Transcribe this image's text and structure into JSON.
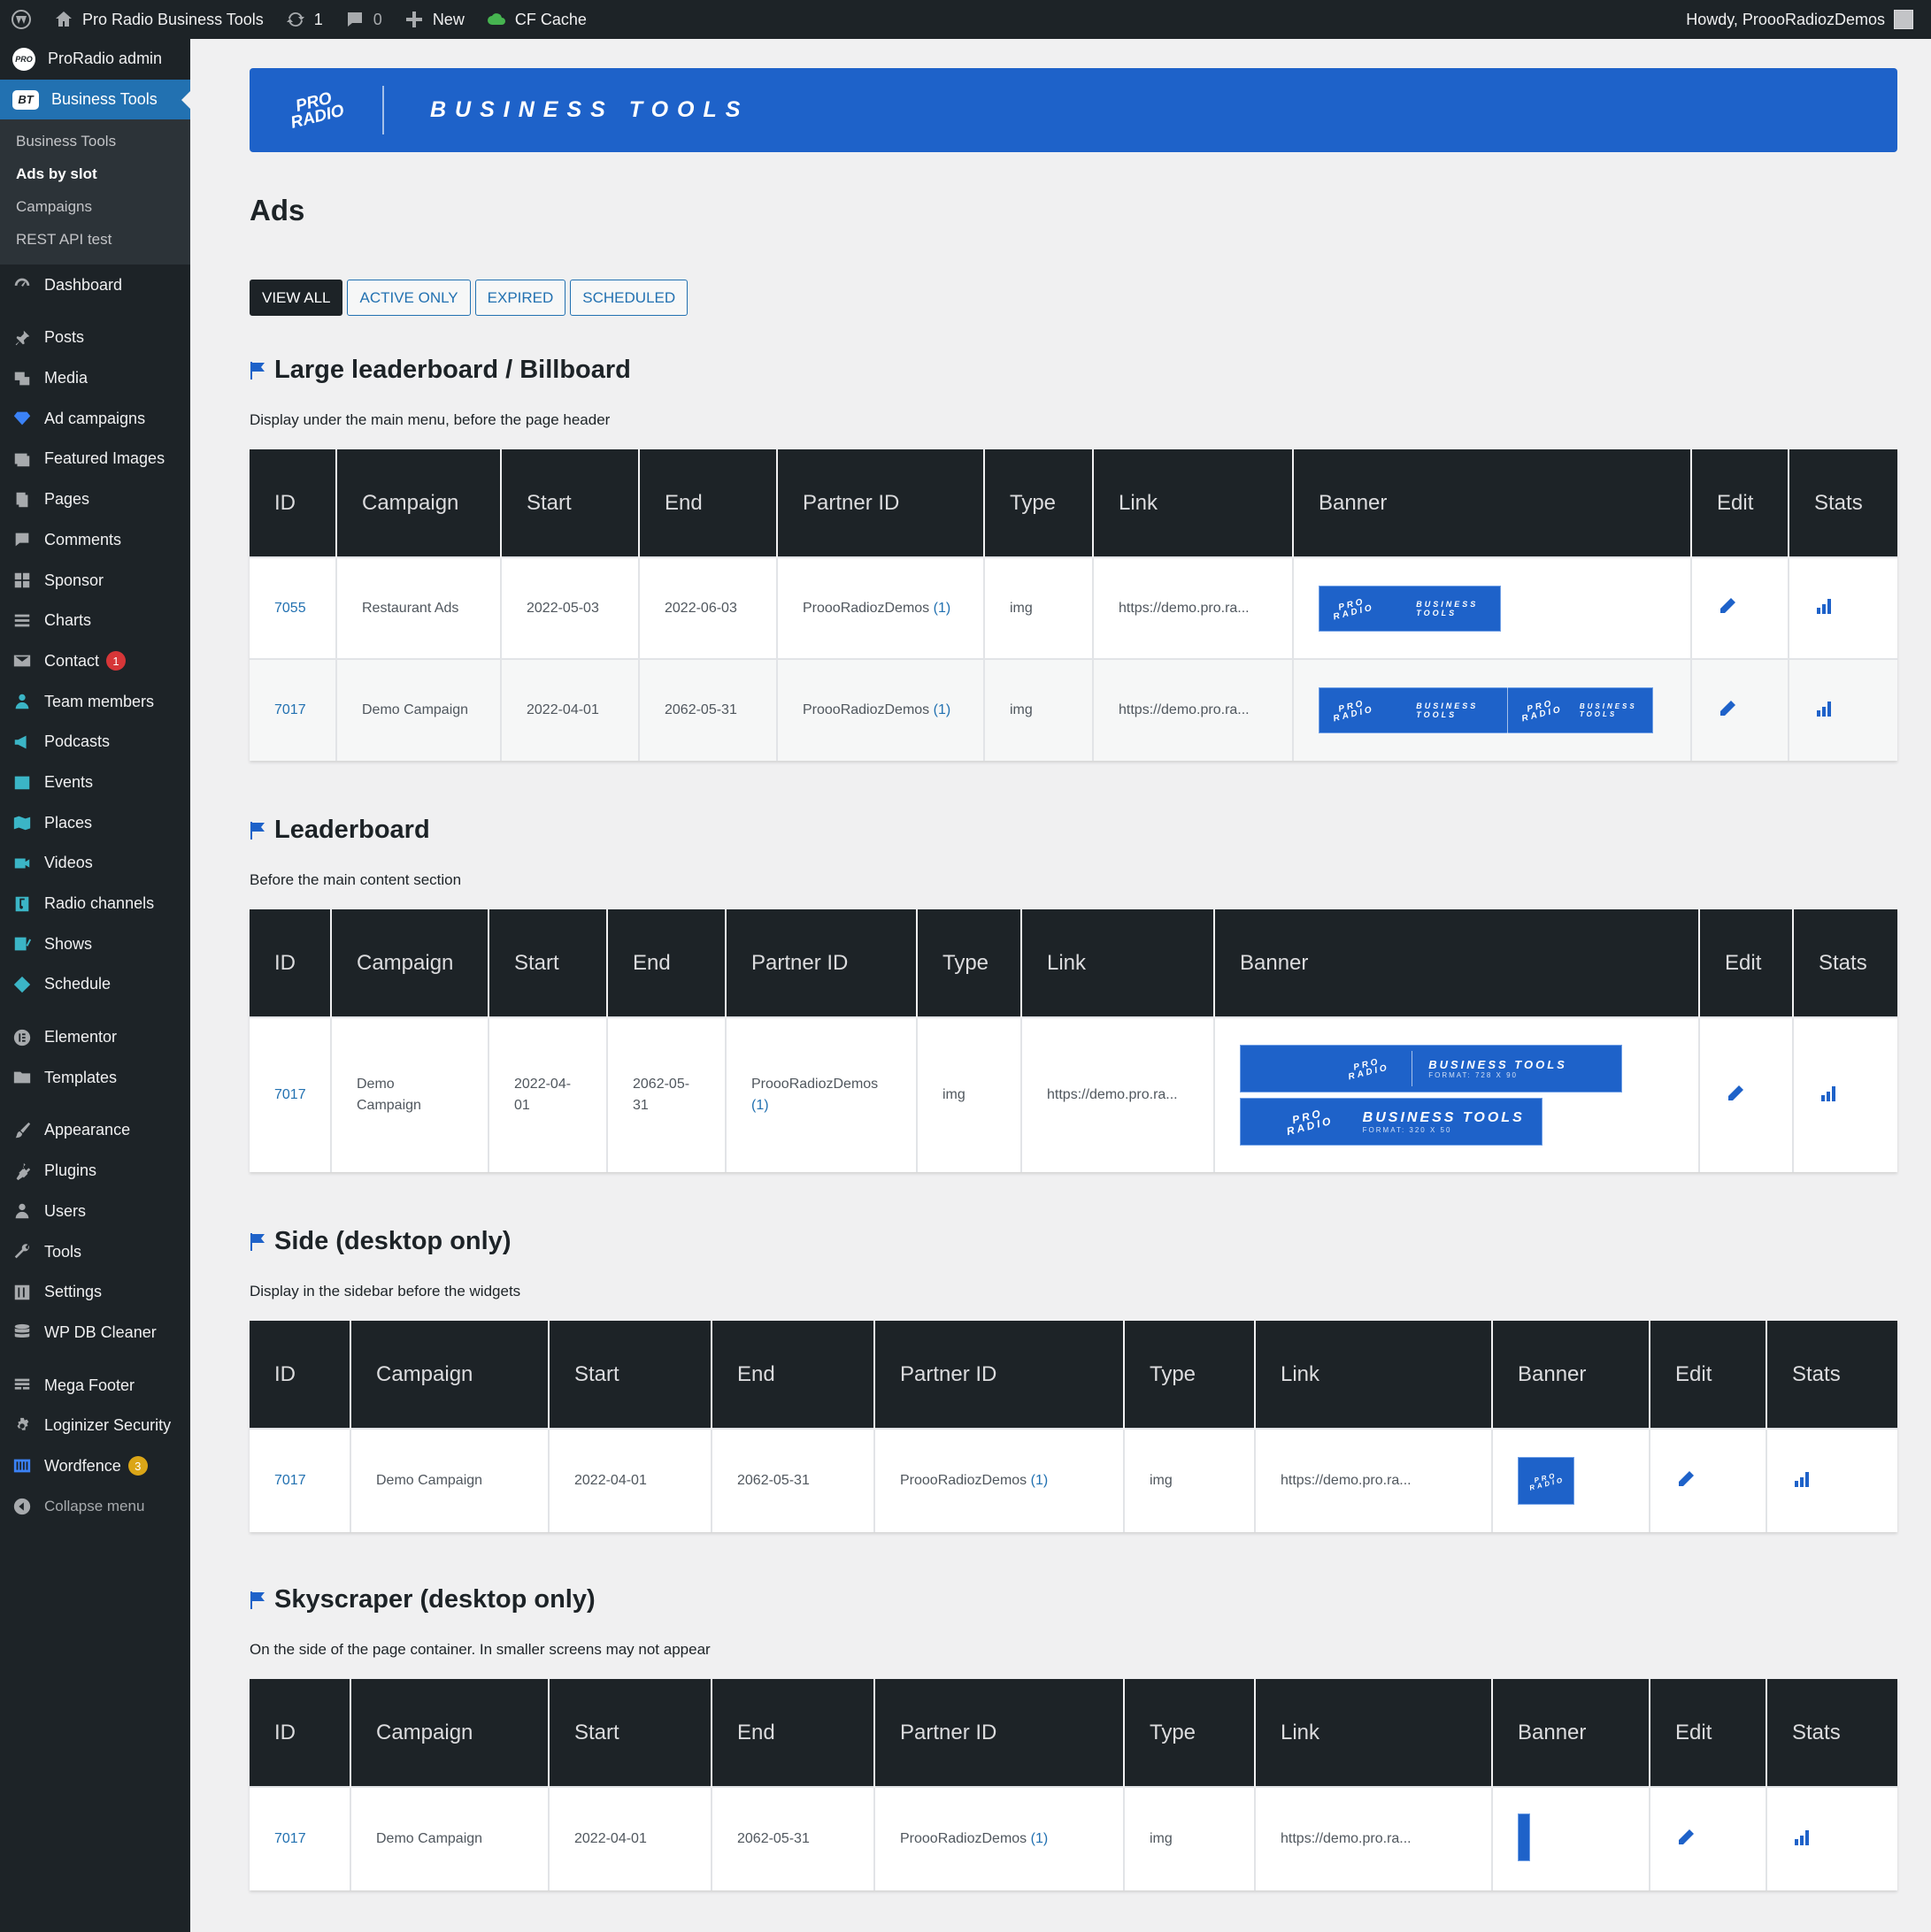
{
  "adminbar": {
    "site_title": "Pro Radio Business Tools",
    "updates_count": "1",
    "comments_count": "0",
    "new_label": "New",
    "cache_label": "CF Cache",
    "greeting": "Howdy, ProooRadiozDemos"
  },
  "sidebar": {
    "proradio_admin": "ProRadio admin",
    "business_tools": "Business Tools",
    "submenu": [
      "Business Tools",
      "Ads by slot",
      "Campaigns",
      "REST API test"
    ],
    "items": {
      "dashboard": "Dashboard",
      "posts": "Posts",
      "media": "Media",
      "ad_campaigns": "Ad campaigns",
      "featured_images": "Featured Images",
      "pages": "Pages",
      "comments": "Comments",
      "sponsor": "Sponsor",
      "charts": "Charts",
      "contact": "Contact",
      "contact_badge": "1",
      "team_members": "Team members",
      "podcasts": "Podcasts",
      "events": "Events",
      "places": "Places",
      "videos": "Videos",
      "radio_channels": "Radio channels",
      "shows": "Shows",
      "schedule": "Schedule",
      "elementor": "Elementor",
      "templates": "Templates",
      "appearance": "Appearance",
      "plugins": "Plugins",
      "users": "Users",
      "tools": "Tools",
      "settings": "Settings",
      "wp_db_cleaner": "WP DB Cleaner",
      "mega_footer": "Mega Footer",
      "loginizer": "Loginizer Security",
      "wordfence": "Wordfence",
      "wordfence_badge": "3",
      "collapse": "Collapse menu"
    }
  },
  "header": {
    "brand_title": "BUSINESS TOOLS",
    "logo_text": "PRO RADIO"
  },
  "page_title": "Ads",
  "filters": [
    "VIEW ALL",
    "ACTIVE ONLY",
    "EXPIRED",
    "SCHEDULED"
  ],
  "columns": [
    "ID",
    "Campaign",
    "Start",
    "End",
    "Partner ID",
    "Type",
    "Link",
    "Banner",
    "Edit",
    "Stats"
  ],
  "banner": {
    "text": "BUSINESS TOOLS",
    "fmt_728": "FORMAT: 728 X 90",
    "fmt_320": "FORMAT: 320 X 50"
  },
  "sections": [
    {
      "title": "Large leaderboard / Billboard",
      "desc": "Display under the main menu, before the page header",
      "rows": [
        {
          "id": "7055",
          "campaign": "Restaurant Ads",
          "start": "2022-05-03",
          "end": "2022-06-03",
          "partner": "ProooRadiozDemos",
          "partner_count": "(1)",
          "type": "img",
          "link": "https://demo.pro.ra..."
        },
        {
          "id": "7017",
          "campaign": "Demo Campaign",
          "start": "2022-04-01",
          "end": "2062-05-31",
          "partner": "ProooRadiozDemos",
          "partner_count": "(1)",
          "type": "img",
          "link": "https://demo.pro.ra..."
        }
      ]
    },
    {
      "title": "Leaderboard",
      "desc": "Before the main content section",
      "rows": [
        {
          "id": "7017",
          "campaign": "Demo Campaign",
          "start": "2022-04-01",
          "end": "2062-05-31",
          "partner": "ProooRadiozDemos",
          "partner_count": "(1)",
          "type": "img",
          "link": "https://demo.pro.ra..."
        }
      ]
    },
    {
      "title": "Side (desktop only)",
      "desc": "Display in the sidebar before the widgets",
      "rows": [
        {
          "id": "7017",
          "campaign": "Demo Campaign",
          "start": "2022-04-01",
          "end": "2062-05-31",
          "partner": "ProooRadiozDemos",
          "partner_count": "(1)",
          "type": "img",
          "link": "https://demo.pro.ra..."
        }
      ]
    },
    {
      "title": "Skyscraper (desktop only)",
      "desc": "On the side of the page container. In smaller screens may not appear",
      "rows": [
        {
          "id": "7017",
          "campaign": "Demo Campaign",
          "start": "2022-04-01",
          "end": "2062-05-31",
          "partner": "ProooRadiozDemos",
          "partner_count": "(1)",
          "type": "img",
          "link": "https://demo.pro.ra..."
        }
      ]
    }
  ],
  "colors": {
    "accent": "#1e62c9",
    "dark": "#1d2327",
    "link": "#2271b1"
  }
}
